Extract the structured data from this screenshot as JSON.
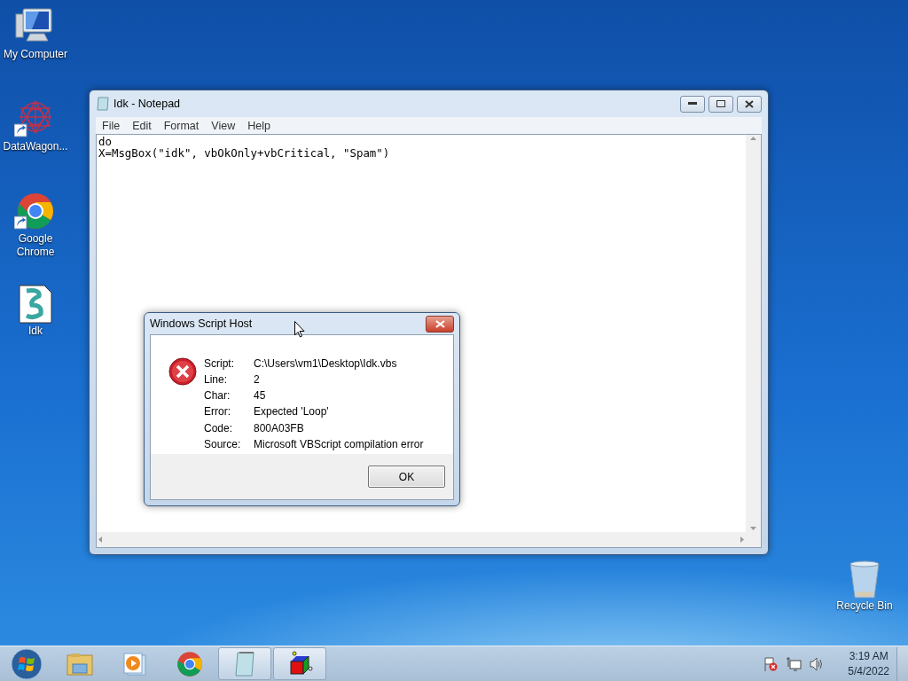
{
  "desktop_icons": [
    {
      "kind": "computer",
      "label": "My Computer",
      "shortcut": false
    },
    {
      "kind": "datawagon",
      "label": "DataWagon...",
      "shortcut": true
    },
    {
      "kind": "chrome",
      "label": "Google Chrome",
      "shortcut": true
    },
    {
      "kind": "script",
      "label": "Idk",
      "shortcut": false
    },
    {
      "kind": "recycle",
      "label": "Recycle Bin",
      "shortcut": false
    }
  ],
  "notepad": {
    "title": "Idk - Notepad",
    "menu": [
      "File",
      "Edit",
      "Format",
      "View",
      "Help"
    ],
    "lines": [
      "do",
      "X=MsgBox(\"idk\", vbOkOnly+vbCritical, \"Spam\")"
    ]
  },
  "dialog": {
    "title": "Windows Script Host",
    "fields": [
      {
        "label": "Script:",
        "value": "C:\\Users\\vm1\\Desktop\\Idk.vbs"
      },
      {
        "label": "Line:",
        "value": "2"
      },
      {
        "label": "Char:",
        "value": "45"
      },
      {
        "label": "Error:",
        "value": "Expected 'Loop'"
      },
      {
        "label": "Code:",
        "value": "800A03FB"
      },
      {
        "label": "Source:",
        "value": "Microsoft VBScript compilation error"
      }
    ],
    "button": "OK"
  },
  "taskbar": {
    "items": [
      {
        "kind": "explorer",
        "open": false
      },
      {
        "kind": "media",
        "open": false
      },
      {
        "kind": "chrome",
        "open": false
      },
      {
        "kind": "notepad",
        "open": true
      },
      {
        "kind": "cube",
        "open": true
      }
    ],
    "time": "3:19 AM",
    "date": "5/4/2022"
  }
}
